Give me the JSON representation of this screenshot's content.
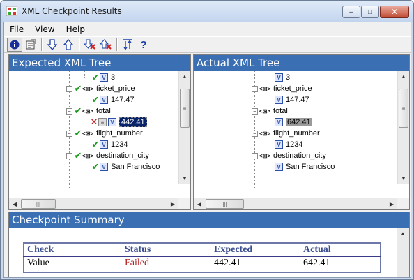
{
  "window": {
    "title": "XML Checkpoint Results",
    "min_label": "–",
    "max_label": "□",
    "close_label": "✕"
  },
  "menu": {
    "items": [
      "File",
      "View",
      "Help"
    ]
  },
  "toolbar": {
    "buttons": [
      {
        "icon": "info-icon",
        "glyph": "i"
      },
      {
        "icon": "properties-icon",
        "glyph": "⚒"
      },
      {
        "icon": "next-mismatch-down-icon",
        "glyph": "⇩"
      },
      {
        "icon": "prev-mismatch-up-icon",
        "glyph": "⇧"
      },
      {
        "icon": "next-error-icon",
        "glyph": "✕"
      },
      {
        "icon": "prev-error-icon",
        "glyph": "✕"
      },
      {
        "icon": "sort-icon",
        "glyph": "⇅"
      },
      {
        "icon": "help-icon",
        "glyph": "?"
      }
    ]
  },
  "expected_tree": {
    "header": "Expected XML Tree",
    "rows": [
      {
        "label": "3",
        "type": "value",
        "status": "ok"
      },
      {
        "label": "ticket_price",
        "type": "element",
        "status": "ok"
      },
      {
        "label": "147.47",
        "type": "value",
        "status": "ok"
      },
      {
        "label": "total",
        "type": "element",
        "status": "ok"
      },
      {
        "label": "442.41",
        "type": "value",
        "status": "failed",
        "selected": true
      },
      {
        "label": "flight_number",
        "type": "element",
        "status": "ok"
      },
      {
        "label": "1234",
        "type": "value",
        "status": "ok"
      },
      {
        "label": "destination_city",
        "type": "element",
        "status": "ok"
      },
      {
        "label": "San Francisco",
        "type": "value",
        "status": "ok"
      }
    ]
  },
  "actual_tree": {
    "header": "Actual XML Tree",
    "rows": [
      {
        "label": "3",
        "type": "value"
      },
      {
        "label": "ticket_price",
        "type": "element"
      },
      {
        "label": "147.47",
        "type": "value"
      },
      {
        "label": "total",
        "type": "element"
      },
      {
        "label": "642.41",
        "type": "value",
        "highlighted": true
      },
      {
        "label": "flight_number",
        "type": "element"
      },
      {
        "label": "1234",
        "type": "value"
      },
      {
        "label": "destination_city",
        "type": "element"
      },
      {
        "label": "San Francisco",
        "type": "value"
      }
    ]
  },
  "summary": {
    "header": "Checkpoint Summary",
    "columns": [
      "Check",
      "Status",
      "Expected",
      "Actual"
    ],
    "rows": [
      {
        "check": "Value",
        "status": "Failed",
        "expected": "442.41",
        "actual": "642.41"
      }
    ]
  },
  "colors": {
    "header_blue": "#3b6fb3",
    "ok_green": "#1a9a1a",
    "failed_red": "#b01a1a",
    "selection": "#0a246a"
  }
}
